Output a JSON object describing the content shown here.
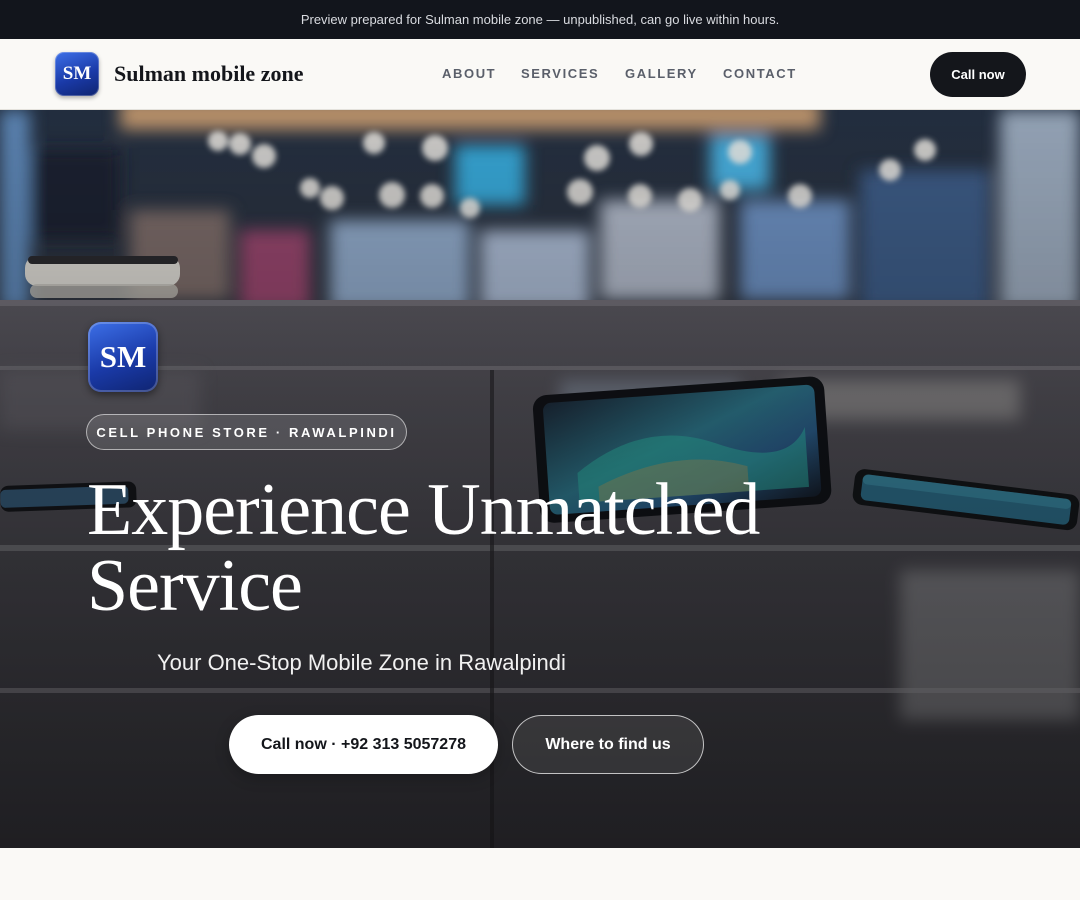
{
  "preview_bar": {
    "text": "Preview prepared for Sulman mobile zone — unpublished, can go live within hours."
  },
  "header": {
    "logo_text": "SM",
    "brand_name": "Sulman mobile zone",
    "nav": [
      {
        "label": "ABOUT"
      },
      {
        "label": "SERVICES"
      },
      {
        "label": "GALLERY"
      },
      {
        "label": "CONTACT"
      }
    ],
    "cta_label": "Call now"
  },
  "hero": {
    "logo_text": "SM",
    "tag": "CELL PHONE STORE · RAWALPINDI",
    "title": "Experience Unmatched Service",
    "subtitle": "Your One-Stop Mobile Zone in Rawalpindi",
    "primary_button": "Call now · +92 313 5057278",
    "secondary_button": "Where to find us"
  },
  "colors": {
    "dark": "#12151c",
    "accent_blue": "#1a3aa8",
    "background": "#faf9f6"
  }
}
